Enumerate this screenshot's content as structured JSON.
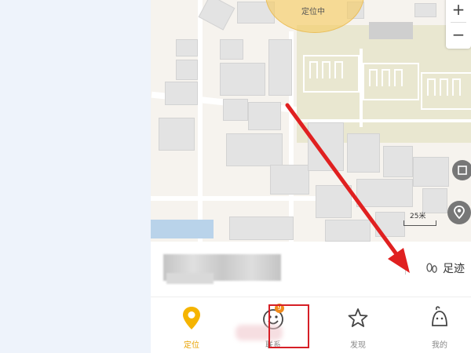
{
  "map": {
    "location_label": "定位中",
    "zoom_in": "+",
    "zoom_out": "−",
    "scale_label": "25米"
  },
  "info": {
    "footprint_label": "足迹"
  },
  "tabs": [
    {
      "label": "定位"
    },
    {
      "label": "联系",
      "badge": "9"
    },
    {
      "label": "发现"
    },
    {
      "label": "我的"
    }
  ],
  "colors": {
    "accent": "#f5b400",
    "highlight": "#d61f26",
    "arrow": "#e02020"
  }
}
